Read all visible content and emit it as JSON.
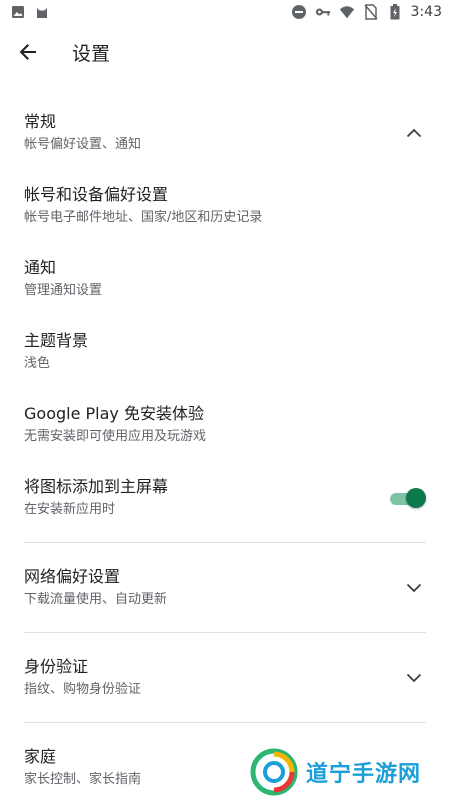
{
  "status_bar": {
    "time": "3:43",
    "left_icons": [
      "image-icon",
      "cat-icon"
    ],
    "right_icons": [
      "do-not-disturb-icon",
      "key-icon",
      "wifi-icon",
      "no-sim-icon",
      "battery-charging-icon"
    ]
  },
  "app_bar": {
    "title": "设置"
  },
  "settings": {
    "general": {
      "title": "常规",
      "subtitle": "帐号偏好设置、通知"
    },
    "account": {
      "title": "帐号和设备偏好设置",
      "subtitle": "帐号电子邮件地址、国家/地区和历史记录"
    },
    "notifications": {
      "title": "通知",
      "subtitle": "管理通知设置"
    },
    "theme": {
      "title": "主题背景",
      "subtitle": "浅色"
    },
    "instant": {
      "title": "Google Play 免安装体验",
      "subtitle": "无需安装即可使用应用及玩游戏"
    },
    "home_icon": {
      "title": "将图标添加到主屏幕",
      "subtitle": "在安装新应用时",
      "enabled": true
    },
    "network": {
      "title": "网络偏好设置",
      "subtitle": "下载流量使用、自动更新"
    },
    "auth": {
      "title": "身份验证",
      "subtitle": "指纹、购物身份验证"
    },
    "family": {
      "title": "家庭",
      "subtitle": "家长控制、家长指南"
    }
  },
  "watermark": {
    "text": "道宁手游网"
  },
  "colors": {
    "accent": "#0b7a4b",
    "track": "#7cc2a4",
    "watermark": "#1a9fd8"
  }
}
